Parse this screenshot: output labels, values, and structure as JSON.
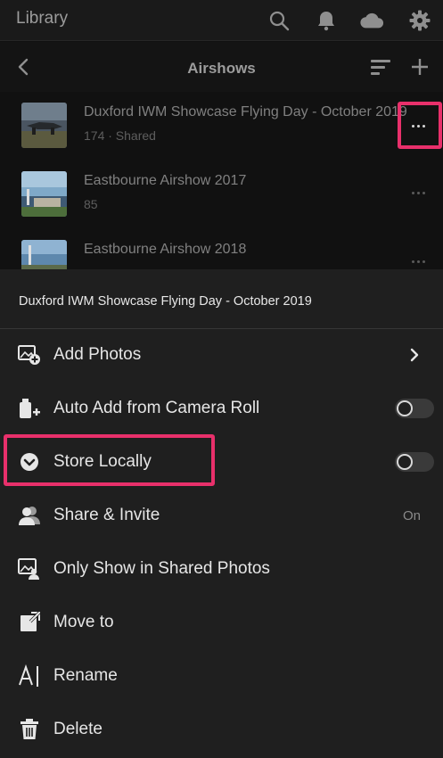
{
  "appbar": {
    "title": "Library",
    "icons": [
      "search-icon",
      "bell-icon",
      "cloud-icon",
      "gear-icon"
    ]
  },
  "subheader": {
    "title": "Airshows",
    "icons": [
      "back-arrow-icon",
      "sort-icon",
      "add-icon"
    ]
  },
  "albums": [
    {
      "name": "Duxford IWM Showcase Flying Day - October 2019",
      "meta": "174 · Shared",
      "more_highlighted": true
    },
    {
      "name": "Eastbourne Airshow 2017",
      "meta": "85",
      "more_highlighted": false
    },
    {
      "name": "Eastbourne Airshow 2018",
      "meta": "",
      "more_highlighted": false
    }
  ],
  "sheet": {
    "title": "Duxford IWM Showcase Flying Day - October 2019",
    "items": [
      {
        "label": "Add Photos",
        "icon": "add-photos-icon",
        "control": "chevron"
      },
      {
        "label": "Auto Add from Camera Roll",
        "icon": "auto-add-icon",
        "control": "toggle",
        "on": false
      },
      {
        "label": "Store Locally",
        "icon": "download-circle-icon",
        "control": "toggle",
        "on": false,
        "highlighted": true
      },
      {
        "label": "Share & Invite",
        "icon": "people-icon",
        "control": "status",
        "status": "On"
      },
      {
        "label": "Only Show in Shared Photos",
        "icon": "shared-photos-icon",
        "control": "none"
      },
      {
        "label": "Move to",
        "icon": "move-to-icon",
        "control": "none"
      },
      {
        "label": "Rename",
        "icon": "rename-icon",
        "control": "none"
      },
      {
        "label": "Delete",
        "icon": "trash-icon",
        "control": "none"
      }
    ]
  },
  "colors": {
    "background": "#111111",
    "sheet": "#1f1f1f",
    "highlight": "#e8306b",
    "text": "#e6e6e6"
  }
}
